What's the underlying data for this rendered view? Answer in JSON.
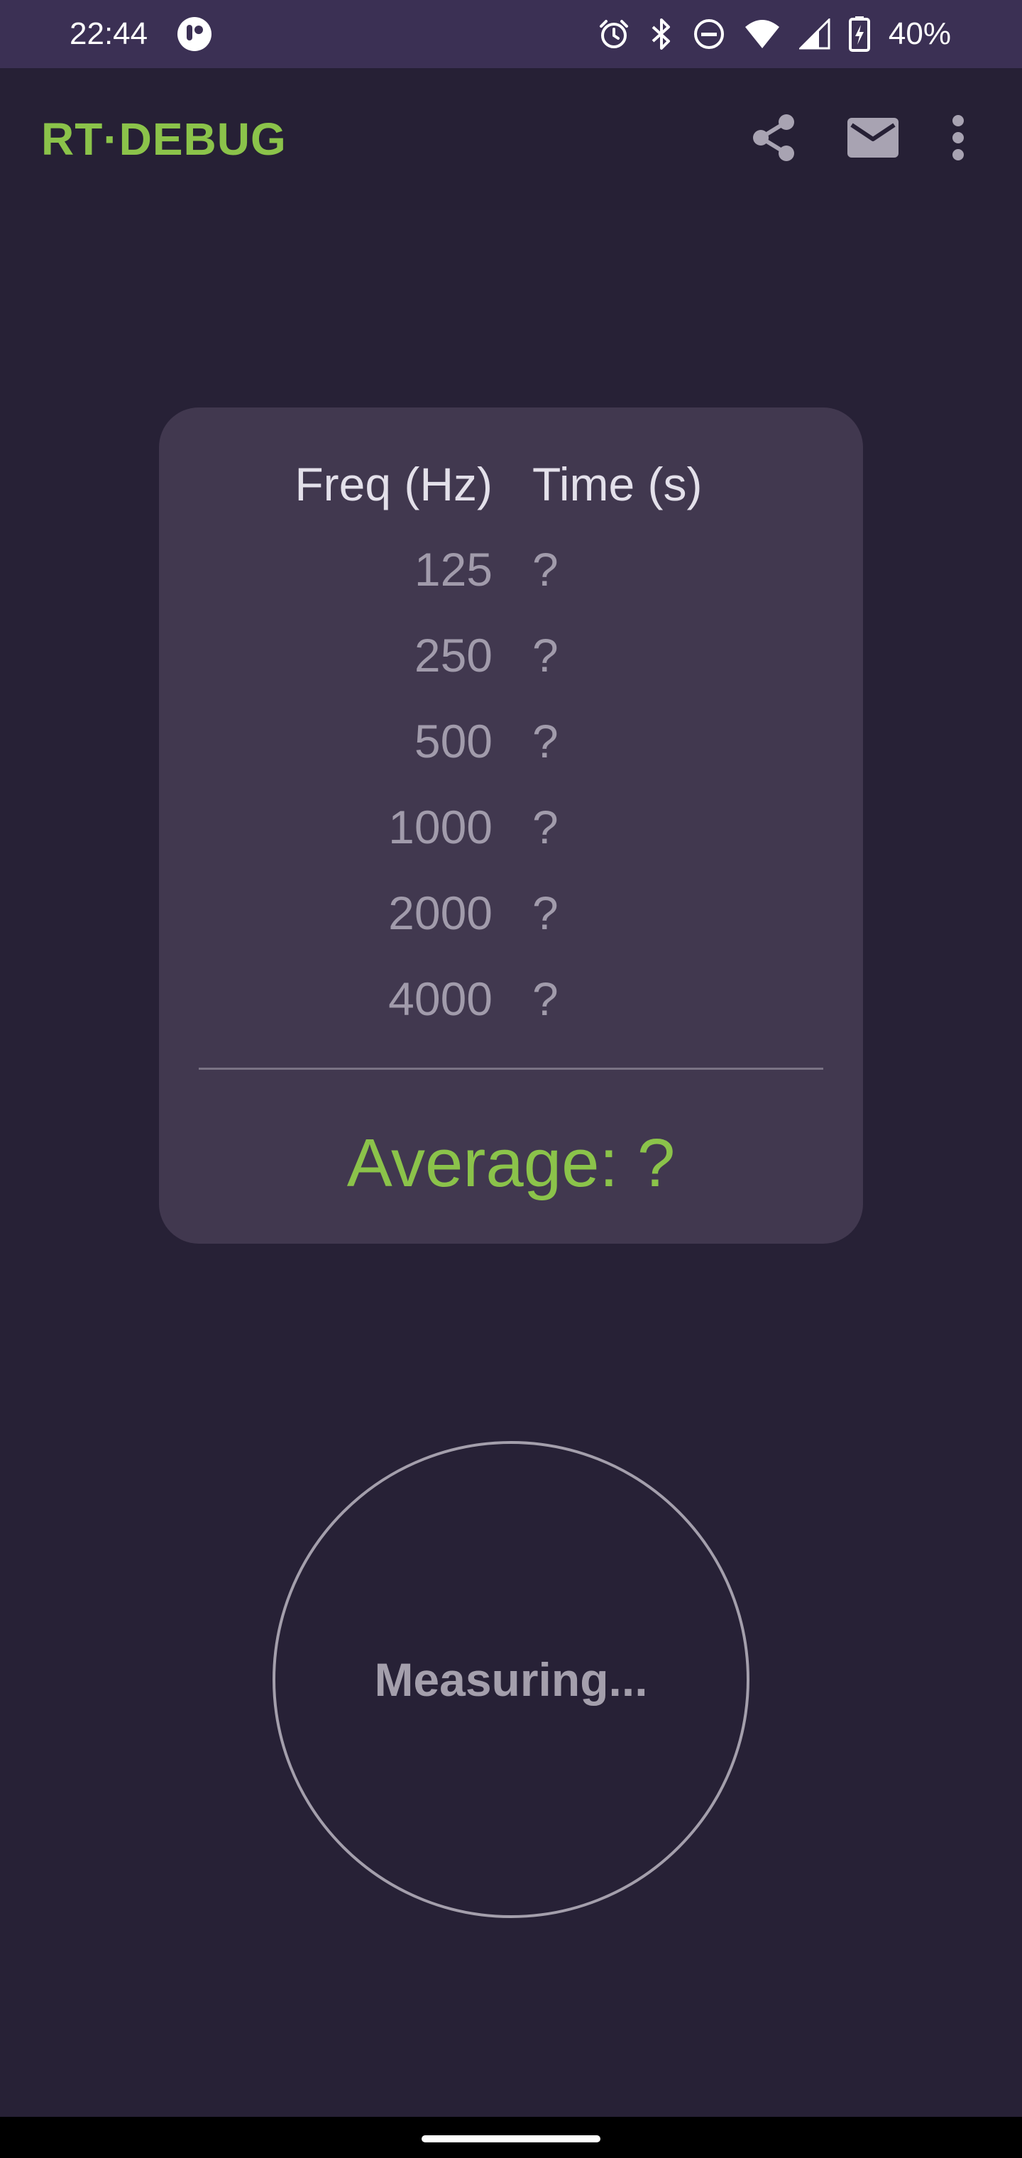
{
  "status_bar": {
    "time": "22:44",
    "battery": "40%",
    "icons": [
      "app-notification-icon",
      "alarm-icon",
      "bluetooth-icon",
      "do-not-disturb-icon",
      "wifi-icon",
      "cellular-signal-icon",
      "battery-charging-icon"
    ]
  },
  "app_bar": {
    "title": "RT·DEBUG",
    "actions": [
      "share-icon",
      "mail-icon",
      "more-vert-icon"
    ]
  },
  "results": {
    "freq_header": "Freq (Hz)",
    "time_header": "Time (s)",
    "rows": [
      {
        "freq": "125",
        "time": "?"
      },
      {
        "freq": "250",
        "time": "?"
      },
      {
        "freq": "500",
        "time": "?"
      },
      {
        "freq": "1000",
        "time": "?"
      },
      {
        "freq": "2000",
        "time": "?"
      },
      {
        "freq": "4000",
        "time": "?"
      }
    ],
    "average": "Average: ?"
  },
  "measure": {
    "label": "Measuring..."
  },
  "colors": {
    "accent": "#8bc34a",
    "background": "#272136",
    "card": "#41384f",
    "status_bar": "#3b3054"
  }
}
